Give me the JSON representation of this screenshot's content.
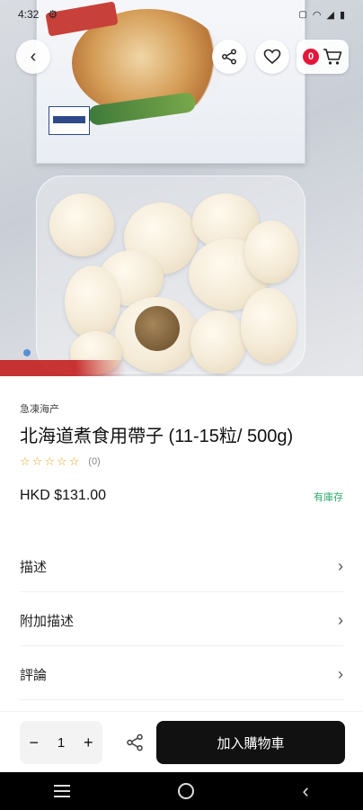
{
  "status_bar": {
    "time": "4:32",
    "icons": [
      "gear-icon",
      "sim-icon",
      "wifi-icon",
      "signal-icon",
      "battery-icon"
    ]
  },
  "header": {
    "cart_count": "0"
  },
  "product": {
    "category": "急凍海产",
    "title": "北海道煮食用帶子 (11-15粒/ 500g)",
    "rating_count": "(0)",
    "price": "HKD $131.00",
    "stock_status": "有庫存"
  },
  "sections": [
    {
      "label": "描述"
    },
    {
      "label": "附加描述"
    },
    {
      "label": "評論"
    }
  ],
  "action_bar": {
    "qty_minus": "−",
    "quantity": "1",
    "qty_plus": "+",
    "add_to_cart": "加入購物車"
  },
  "colors": {
    "accent": "#111111",
    "badge": "#e3173a",
    "stock": "#2fa86b",
    "star": "#e7a526"
  }
}
